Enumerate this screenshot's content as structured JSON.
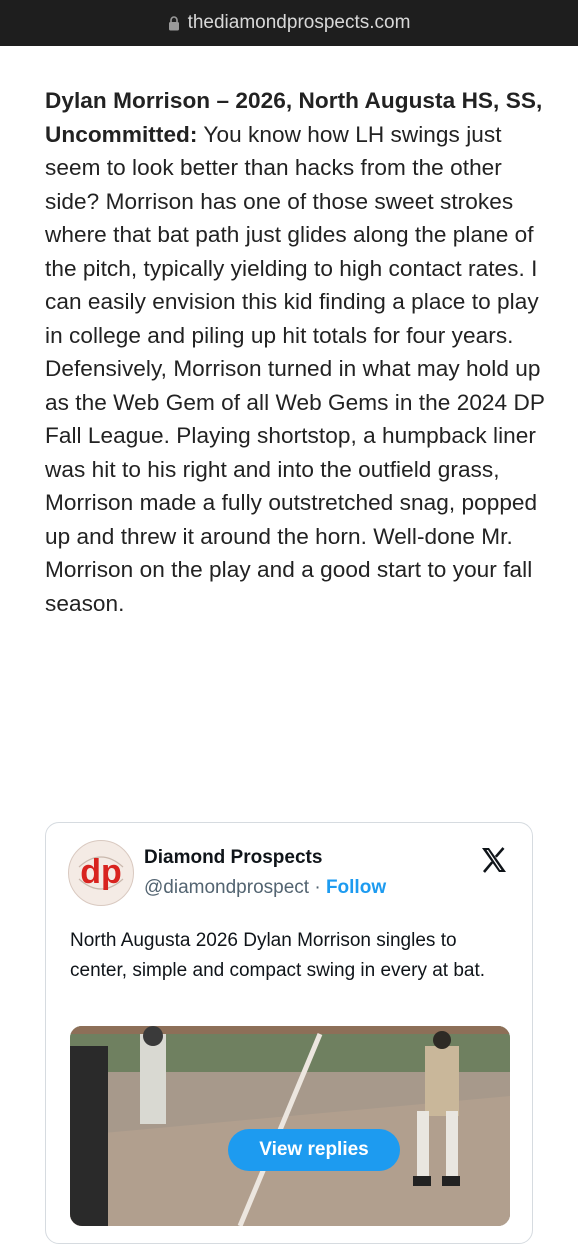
{
  "browser": {
    "url": "thediamondprospects.com"
  },
  "article": {
    "lead": "Dylan Morrison – 2026, North Augusta HS, SS, Uncommitted:",
    "body": " You know how LH swings just seem to look better than hacks from the other side? Morrison has one of those sweet strokes where that bat path just glides along the plane of the pitch, typically yielding to high contact rates. I can easily envision this kid finding a place to play in college and piling up hit totals for four years. Defensively, Morrison turned in what may hold up as the Web Gem of all Web Gems in the 2024 DP Fall League. Playing shortstop, a humpback liner was hit to his right and into the outfield grass, Morrison made a fully outstretched snag, popped up and threw it around the horn. Well-done Mr. Morrison on the play and a good start to your fall season."
  },
  "tweet": {
    "avatar_text": "dp",
    "name": "Diamond Prospects",
    "handle": "@diamondprospect",
    "separator": "·",
    "follow_label": "Follow",
    "text": "North Augusta 2026 Dylan Morrison singles to center, simple and compact swing in every at bat.",
    "view_replies_label": "View replies",
    "colors": {
      "accent": "#1d9bf0",
      "avatar_red": "#d8231f"
    }
  }
}
